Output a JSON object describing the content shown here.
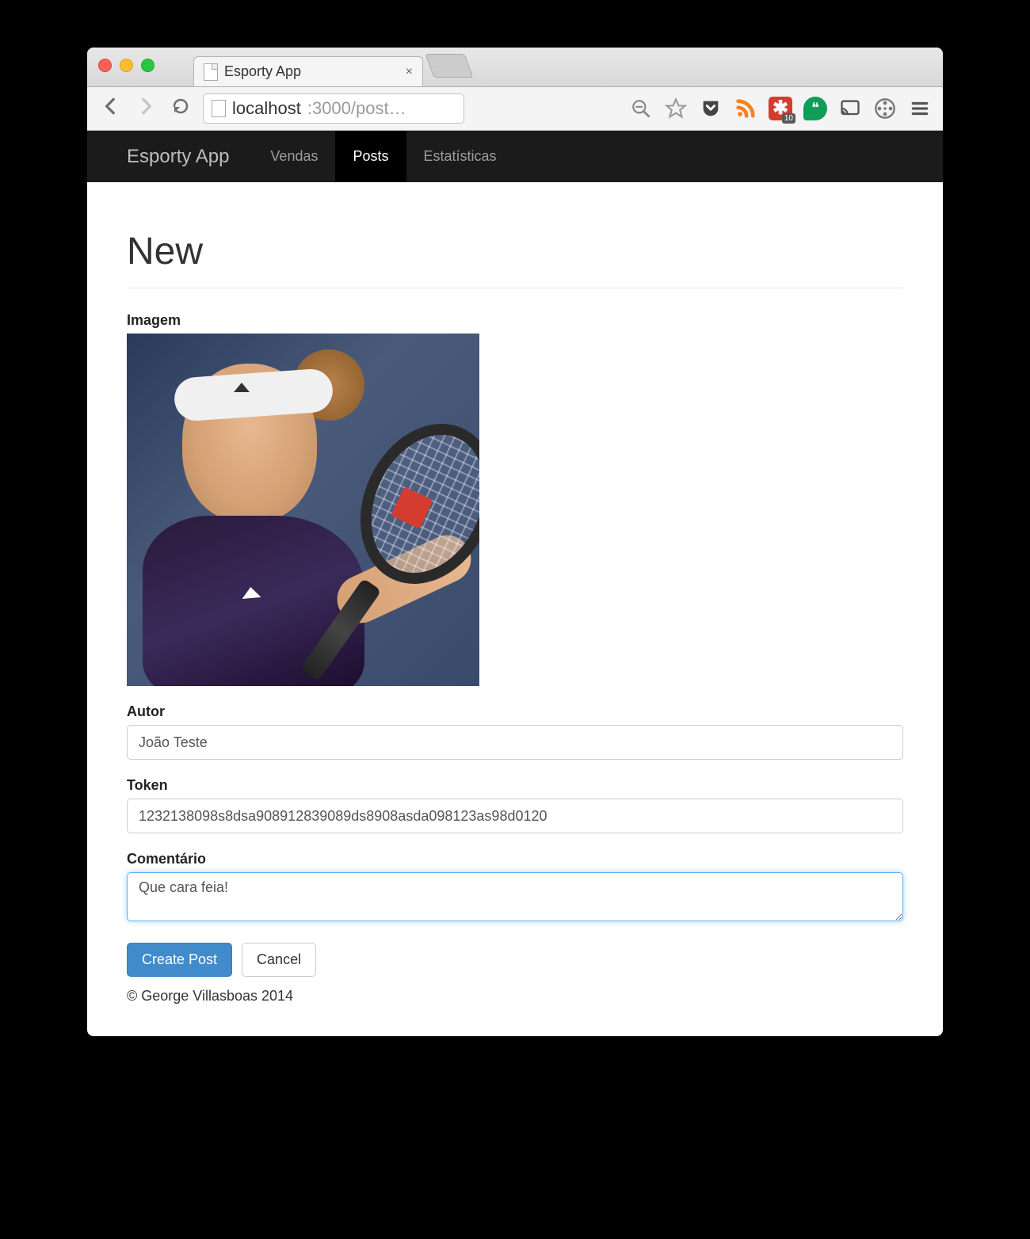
{
  "browser": {
    "tab_title": "Esporty App",
    "url_host": "localhost",
    "url_port_path": ":3000/post…",
    "asterisk_badge": "10"
  },
  "navbar": {
    "brand": "Esporty App",
    "links": [
      {
        "label": "Vendas",
        "active": false
      },
      {
        "label": "Posts",
        "active": true
      },
      {
        "label": "Estatísticas",
        "active": false
      }
    ]
  },
  "page": {
    "title": "New",
    "image_label": "Imagem",
    "shirt_logo_text": "",
    "autor_label": "Autor",
    "autor_value": "João Teste",
    "token_label": "Token",
    "token_value": "1232138098s8dsa908912839089ds8908asda098123as98d0120",
    "comentario_label": "Comentário",
    "comentario_value": "Que cara feia!",
    "submit_label": "Create Post",
    "cancel_label": "Cancel",
    "footer": "© George Villasboas 2014"
  }
}
